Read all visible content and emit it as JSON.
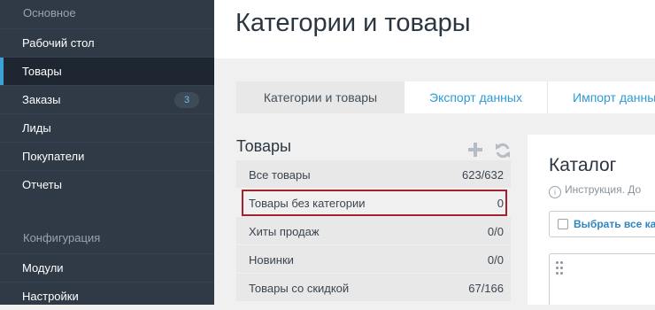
{
  "sidebar": {
    "section_main": "Основное",
    "items": [
      {
        "label": "Рабочий стол"
      },
      {
        "label": "Товары"
      },
      {
        "label": "Заказы",
        "badge": "3"
      },
      {
        "label": "Лиды"
      },
      {
        "label": "Покупатели"
      },
      {
        "label": "Отчеты"
      }
    ],
    "section_config": "Конфигурация",
    "config_items": [
      {
        "label": "Модули"
      },
      {
        "label": "Настройки"
      }
    ],
    "active_item": "Товары"
  },
  "header": {
    "title": "Категории и товары"
  },
  "tabs": [
    {
      "label": "Категории и товары",
      "active": true
    },
    {
      "label": "Экспорт данных"
    },
    {
      "label": "Импорт данных"
    }
  ],
  "products_panel": {
    "title": "Товары",
    "add_icon": "plus-icon",
    "refresh_icon": "refresh-icon",
    "categories": [
      {
        "label": "Все товары",
        "count": "623/632"
      },
      {
        "label": "Товары без категории",
        "count": "0"
      },
      {
        "label": "Хиты продаж",
        "count": "0/0"
      },
      {
        "label": "Новинки",
        "count": "0/0"
      },
      {
        "label": "Товары со скидкой",
        "count": "67/166"
      }
    ],
    "highlighted": "Товары без категории"
  },
  "catalog": {
    "title": "Каталог",
    "instruction": "Инструкция. До",
    "select_all_label": "Выбрать все ка"
  },
  "colors": {
    "sidebar_bg": "#2f3a46",
    "accent": "#2e9bd6",
    "highlight_border": "#a4222d"
  }
}
